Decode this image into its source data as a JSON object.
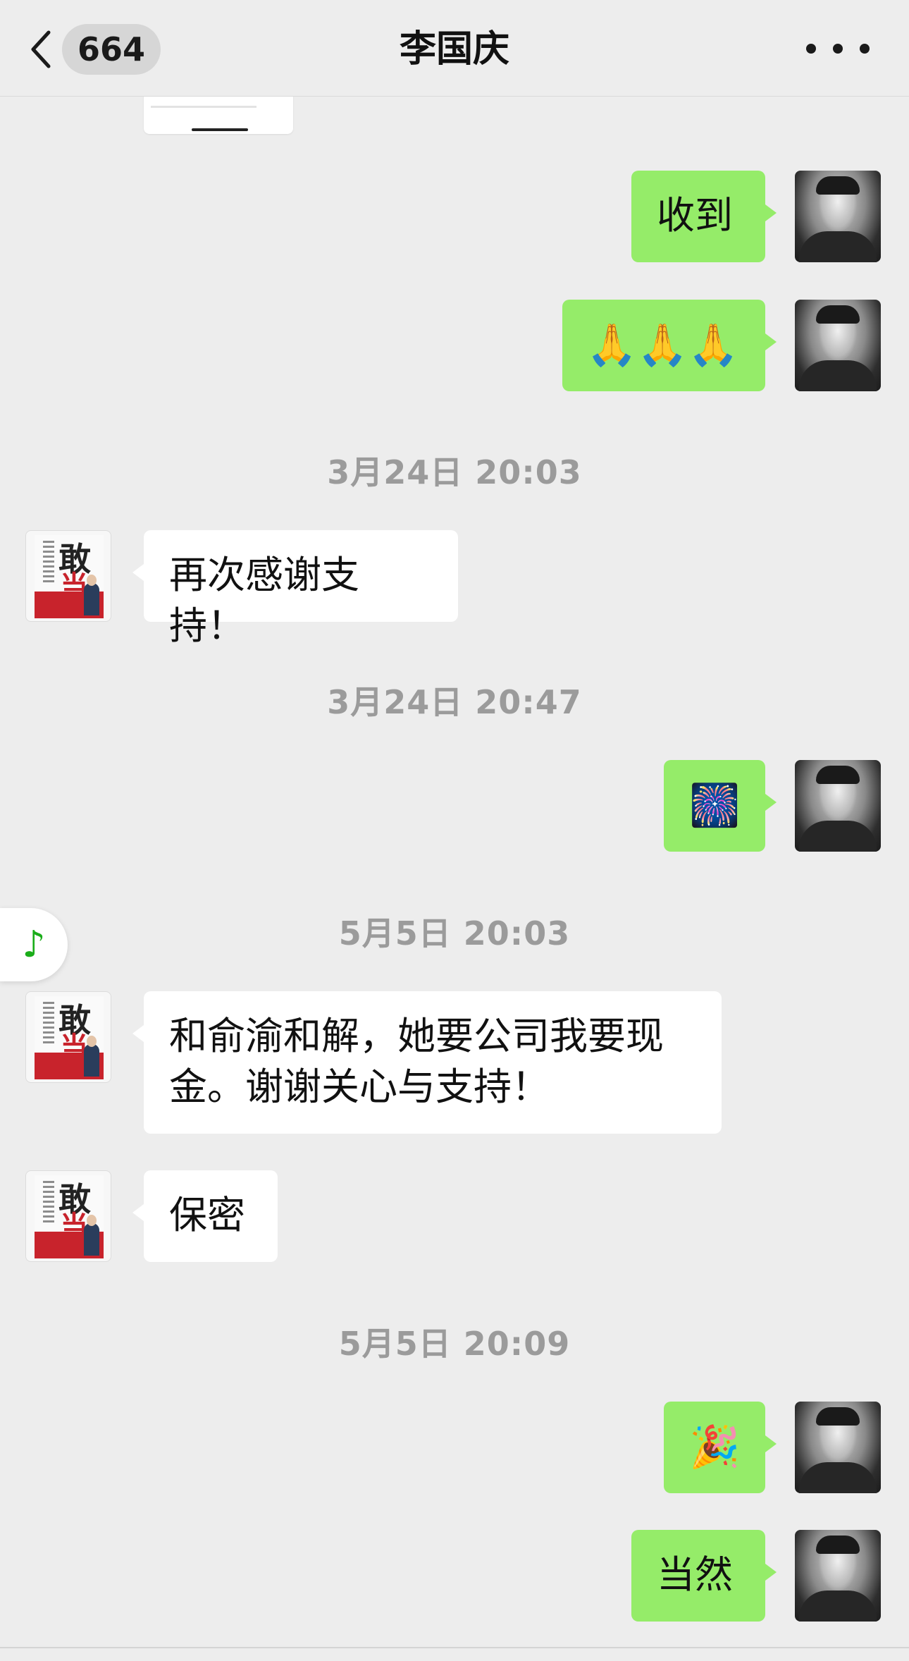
{
  "header": {
    "unread_count": "664",
    "title": "李国庆"
  },
  "messages": [
    {
      "side": "self",
      "type": "text",
      "text": "收到"
    },
    {
      "side": "self",
      "type": "emoji",
      "text": "🙏🙏🙏"
    },
    {
      "type": "timestamp",
      "text": "3月24日 20:03"
    },
    {
      "side": "other",
      "type": "text",
      "text": "再次感谢支持！"
    },
    {
      "type": "timestamp",
      "text": "3月24日 20:47"
    },
    {
      "side": "self",
      "type": "emoji",
      "text": "🎆"
    },
    {
      "type": "timestamp",
      "text": "5月5日 20:03"
    },
    {
      "side": "other",
      "type": "text",
      "lines": [
        "和俞渝和解，她要公司我要现",
        "金。谢谢关心与支持！"
      ]
    },
    {
      "side": "other",
      "type": "text",
      "text": "保密"
    },
    {
      "type": "timestamp",
      "text": "5月5日 20:09"
    },
    {
      "side": "self",
      "type": "emoji",
      "text": "🎉"
    },
    {
      "side": "self",
      "type": "text",
      "text": "当然"
    }
  ],
  "avatars": {
    "book_cover_chars": [
      "敢",
      "当"
    ]
  },
  "music_button": {
    "icon": "music-note-icon",
    "glyph": "♪"
  },
  "colors": {
    "self_bubble": "#95ec69",
    "other_bubble": "#ffffff",
    "background": "#ededed",
    "timestamp": "#9b9b9b"
  }
}
